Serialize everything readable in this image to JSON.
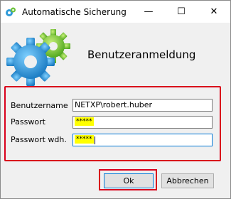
{
  "window": {
    "title": "Automatische Sicherung",
    "controls": {
      "minimize": "—",
      "maximize": "☐",
      "close": "✕"
    }
  },
  "header": {
    "heading": "Benutzeranmeldung"
  },
  "form": {
    "username_label": "Benutzername",
    "username_value": "NETXP\\robert.huber",
    "password_label": "Passwort",
    "password_value": "*****",
    "password_repeat_label": "Passwort wdh.",
    "password_repeat_value": "*****"
  },
  "buttons": {
    "ok": "Ok",
    "cancel": "Abbrechen"
  },
  "colors": {
    "highlight": "#d9001b",
    "mask_bg": "#ffff00",
    "focus": "#0078d7"
  },
  "icons": {
    "app": "gear-icon",
    "header_art": "gears-icon"
  }
}
